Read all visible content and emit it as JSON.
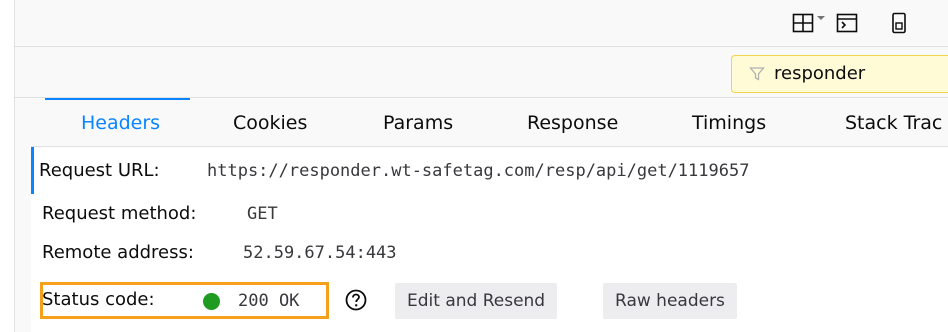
{
  "toolbar": {
    "icons": [
      "layout-split-icon",
      "chevron-down-icon",
      "console-split-icon",
      "device-icon"
    ]
  },
  "filter": {
    "value": "responder",
    "icon": "filter-icon"
  },
  "tabs": [
    {
      "label": "Headers",
      "active": true
    },
    {
      "label": "Cookies",
      "active": false
    },
    {
      "label": "Params",
      "active": false
    },
    {
      "label": "Response",
      "active": false
    },
    {
      "label": "Timings",
      "active": false
    },
    {
      "label": "Stack Trac",
      "active": false
    }
  ],
  "details": {
    "request_url": {
      "label": "Request URL:",
      "value": "https://responder.wt-safetag.com/resp/api/get/1119657"
    },
    "request_method": {
      "label": "Request method:",
      "value": "GET"
    },
    "remote_address": {
      "label": "Remote address:",
      "value": "52.59.67.54:443"
    },
    "status": {
      "label": "Status code:",
      "value": "200 OK",
      "color": "#1f9b22",
      "highlight_color": "#f6a11b"
    }
  },
  "buttons": {
    "edit_resend": "Edit and Resend",
    "raw_headers": "Raw headers"
  },
  "colors": {
    "accent": "#0a84ff",
    "filter_bg": "#fffbd6",
    "filter_border": "#f1d34c"
  }
}
